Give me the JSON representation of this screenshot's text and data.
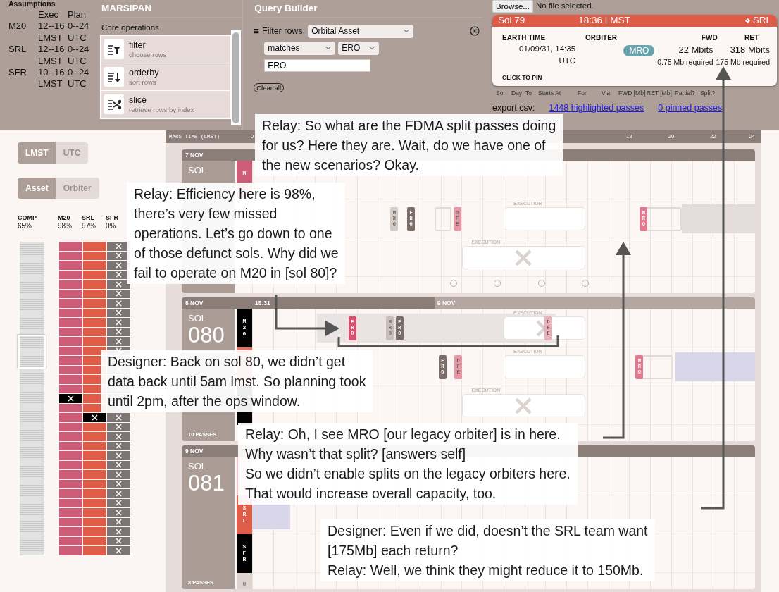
{
  "assumptions": {
    "title": "Assumptions",
    "columns": [
      "Exec",
      "Plan"
    ],
    "rows": [
      {
        "asset": "M20",
        "exec": "12--16",
        "plan": "0--24",
        "exec_unit": "LMST",
        "plan_unit": "UTC"
      },
      {
        "asset": "SRL",
        "exec": "12--16",
        "plan": "0--24",
        "exec_unit": "LMST",
        "plan_unit": "UTC"
      },
      {
        "asset": "SFR",
        "exec": "10--16",
        "plan": "0--24",
        "exec_unit": "LMST",
        "plan_unit": "UTC"
      }
    ]
  },
  "marsipan": {
    "title": "MARSIPAN",
    "section": "Core operations",
    "operations": [
      {
        "kind": "filter",
        "name": "filter",
        "description": "choose rows"
      },
      {
        "kind": "orderby",
        "name": "orderby",
        "description": "sort rows"
      },
      {
        "kind": "slice",
        "name": "slice",
        "description": "retrieve rows by index"
      }
    ]
  },
  "query_builder": {
    "title": "Query Builder",
    "menu_icon": "≡",
    "filter_label": "Filter rows:",
    "column_select": "Orbital Asset",
    "operator_select": "matches",
    "value_select": "ERO",
    "value_input": "ERO",
    "clear_button": "Clear all"
  },
  "file_input": {
    "button": "Browse...",
    "status": "No file selected."
  },
  "pass_tooltip": {
    "sol": "Sol 79",
    "time": "18:36 LMST",
    "asset": "SRL",
    "headings": [
      "EARTH TIME",
      "ORBITER",
      "FWD",
      "RET"
    ],
    "earth_time": "01/09/31, 14:35",
    "earth_zone": "UTC",
    "orbiter": "MRO",
    "fwd": "22 Mbits",
    "fwd_required": "0.75 Mb required",
    "ret": "318 Mbits",
    "ret_required": "175 Mb required",
    "pin_hint": "CLICK TO PIN"
  },
  "pass_table": {
    "columns": [
      "Sol",
      "Day",
      "To",
      "Starts At",
      "For",
      "Via",
      "FWD [Mb]",
      "RET [Mb]",
      "Partial?",
      "Split?"
    ]
  },
  "export": {
    "label": "export csv:",
    "links": [
      "1448 highlighted passes",
      "0 pinned passes"
    ]
  },
  "time_toggle": [
    {
      "label": "LMST",
      "selected": true
    },
    {
      "label": "UTC",
      "selected": false
    }
  ],
  "group_toggle": [
    {
      "label": "Asset",
      "selected": true
    },
    {
      "label": "Orbiter",
      "selected": false
    }
  ],
  "summary": [
    {
      "label": "COMP",
      "value": "65%"
    },
    {
      "label": "M20",
      "value": "98%"
    },
    {
      "label": "SRL",
      "value": "97%"
    },
    {
      "label": "SFR",
      "value": "0%"
    }
  ],
  "sol_rows": [
    {
      "m20_missed": false,
      "srl_missed": false,
      "sfr_missed": true
    },
    {
      "m20_missed": false,
      "srl_missed": false,
      "sfr_missed": true
    },
    {
      "m20_missed": false,
      "srl_missed": false,
      "sfr_missed": true
    },
    {
      "m20_missed": false,
      "srl_missed": false,
      "sfr_missed": true
    },
    {
      "m20_missed": false,
      "srl_missed": false,
      "sfr_missed": true
    },
    {
      "m20_missed": false,
      "srl_missed": false,
      "sfr_missed": true
    },
    {
      "m20_missed": false,
      "srl_missed": false,
      "sfr_missed": true
    },
    {
      "m20_missed": false,
      "srl_missed": false,
      "sfr_missed": true
    },
    {
      "m20_missed": false,
      "srl_missed": false,
      "sfr_missed": true
    },
    {
      "m20_missed": false,
      "srl_missed": false,
      "sfr_missed": true
    },
    {
      "m20_missed": false,
      "srl_missed": false,
      "sfr_missed": true
    },
    {
      "m20_missed": false,
      "srl_missed": false,
      "sfr_missed": true
    },
    {
      "m20_missed": false,
      "srl_missed": false,
      "sfr_missed": true
    },
    {
      "m20_missed": false,
      "srl_missed": false,
      "sfr_missed": true
    },
    {
      "m20_missed": false,
      "srl_missed": false,
      "sfr_missed": true
    },
    {
      "m20_missed": false,
      "srl_missed": false,
      "sfr_missed": true
    },
    {
      "m20_missed": true,
      "srl_missed": false,
      "sfr_missed": true
    },
    {
      "m20_missed": false,
      "srl_missed": false,
      "sfr_missed": true
    },
    {
      "m20_missed": false,
      "srl_missed": true,
      "sfr_missed": true
    },
    {
      "m20_missed": false,
      "srl_missed": false,
      "sfr_missed": true
    },
    {
      "m20_missed": false,
      "srl_missed": false,
      "sfr_missed": true
    },
    {
      "m20_missed": false,
      "srl_missed": false,
      "sfr_missed": true
    },
    {
      "m20_missed": false,
      "srl_missed": false,
      "sfr_missed": true
    },
    {
      "m20_missed": false,
      "srl_missed": false,
      "sfr_missed": true
    },
    {
      "m20_missed": false,
      "srl_missed": false,
      "sfr_missed": true
    },
    {
      "m20_missed": false,
      "srl_missed": false,
      "sfr_missed": true
    },
    {
      "m20_missed": false,
      "srl_missed": false,
      "sfr_missed": true
    },
    {
      "m20_missed": false,
      "srl_missed": false,
      "sfr_missed": true
    },
    {
      "m20_missed": false,
      "srl_missed": false,
      "sfr_missed": true
    },
    {
      "m20_missed": false,
      "srl_missed": false,
      "sfr_missed": true
    },
    {
      "m20_missed": false,
      "srl_missed": false,
      "sfr_missed": true
    },
    {
      "m20_missed": false,
      "srl_missed": false,
      "sfr_missed": true
    },
    {
      "m20_missed": false,
      "srl_missed": false,
      "sfr_missed": true
    }
  ],
  "timeline": {
    "axis_label": "MARS TIME (LMST)",
    "ticks": [
      "0",
      "18",
      "20",
      "22",
      "24"
    ],
    "sols": [
      {
        "dates": [
          "7 NOV"
        ],
        "sol_label": "SOL",
        "channels": [
          {
            "label": "M",
            "color": "#cc5c78"
          }
        ],
        "rows": [
          {
            "items": []
          },
          {
            "items": [
              {
                "kind": "pass",
                "orbiter": "MRO",
                "color": "#d5ccc8"
              },
              {
                "kind": "pass",
                "orbiter": "ERO",
                "color": "#7b6e69"
              },
              {
                "kind": "frame"
              },
              {
                "kind": "pass",
                "orbiter": "DFE",
                "color": "#e597a6"
              },
              {
                "kind": "execution",
                "label": "EXECUTION"
              },
              {
                "kind": "frame"
              },
              {
                "kind": "pass",
                "orbiter": "MRO",
                "color": "#e07a90"
              },
              {
                "kind": "block",
                "color": "#e4dddb"
              }
            ]
          },
          {
            "items": [
              {
                "kind": "execution",
                "label": "EXECUTION",
                "missed": true
              }
            ]
          }
        ],
        "slots": [
          {
            "filled": false
          },
          {
            "filled": false
          },
          {
            "filled": false
          },
          {
            "filled": false
          }
        ]
      },
      {
        "dates": [
          "8 NOV",
          "15:31",
          "9 NOV"
        ],
        "sol_label": "SOL",
        "sol_number": "080",
        "passes": "10 PASSES",
        "channels": [
          {
            "label": "M20",
            "color": "#000000"
          },
          {
            "color": "#e07060"
          },
          {
            "color": "#000000"
          }
        ],
        "rows": [
          {
            "items": [
              {
                "kind": "block",
                "color": "#e9e4e3"
              },
              {
                "kind": "pass",
                "orbiter": "ERO",
                "color": "#d9506e"
              },
              {
                "kind": "pass",
                "orbiter": "MRO",
                "color": "#c9c0bc"
              },
              {
                "kind": "pass",
                "orbiter": "ERO",
                "color": "#7b6e69"
              },
              {
                "kind": "execution",
                "label": "EXECUTION",
                "missed": true
              },
              {
                "kind": "pass",
                "orbiter": "DFE",
                "color": "#eab1bb"
              }
            ]
          },
          {
            "items": [
              {
                "kind": "pass",
                "orbiter": "ERO",
                "color": "#7b6e69"
              },
              {
                "kind": "pass",
                "orbiter": "DFE",
                "color": "#e597a6"
              },
              {
                "kind": "execution",
                "label": "EXECUTION"
              },
              {
                "kind": "frame"
              },
              {
                "kind": "pass",
                "orbiter": "MRO",
                "color": "#e07a90"
              },
              {
                "kind": "block",
                "color": "#d9d6ea"
              }
            ]
          },
          {
            "items": [
              {
                "kind": "execution",
                "label": "EXECUTION",
                "missed": true
              }
            ]
          }
        ]
      },
      {
        "dates": [
          "9 NOV"
        ],
        "sol_label": "SOL",
        "sol_number": "081",
        "passes": "8 PASSES",
        "channels": [
          {
            "color": "#f1c7cd"
          },
          {
            "label": "SRL",
            "color": "#df5c48"
          },
          {
            "label": "SFR",
            "color": "#000000"
          },
          {
            "label": "U",
            "color": "#ddd4d0"
          }
        ],
        "rows": [
          {
            "items": []
          },
          {
            "items": [
              {
                "kind": "block",
                "color": "#d9d6ea"
              }
            ]
          },
          {
            "items": []
          }
        ]
      }
    ]
  },
  "callouts": [
    {
      "lines": [
        "Relay: So what are the FDMA split passes doing",
        "for us? Here they are. Wait, do we have one of",
        "the new scenarios? Okay."
      ]
    },
    {
      "lines": [
        "Relay: Efficiency here is 98%,",
        "there’s very few missed",
        "operations. Let’s go down to one",
        "of those defunct sols. Why did we",
        "fail to operate on M20 in [sol 80]?"
      ]
    },
    {
      "lines": [
        "Designer: Back on sol 80, we didn’t get",
        "data back until 5am lmst. So planning took",
        "until 2pm, after the ops window."
      ]
    },
    {
      "lines": [
        "Relay: Oh, I see MRO [our legacy orbiter] is in here.",
        "Why wasn’t that split? [answers self]",
        "So we didn’t enable splits on the legacy orbiters here.",
        "That would increase overall capacity, too."
      ]
    },
    {
      "lines": [
        "Designer: Even if we did, doesn’t the SRL team want",
        "[175Mb] each return?",
        "Relay: Well, we think they might reduce it to 150Mb."
      ]
    }
  ]
}
